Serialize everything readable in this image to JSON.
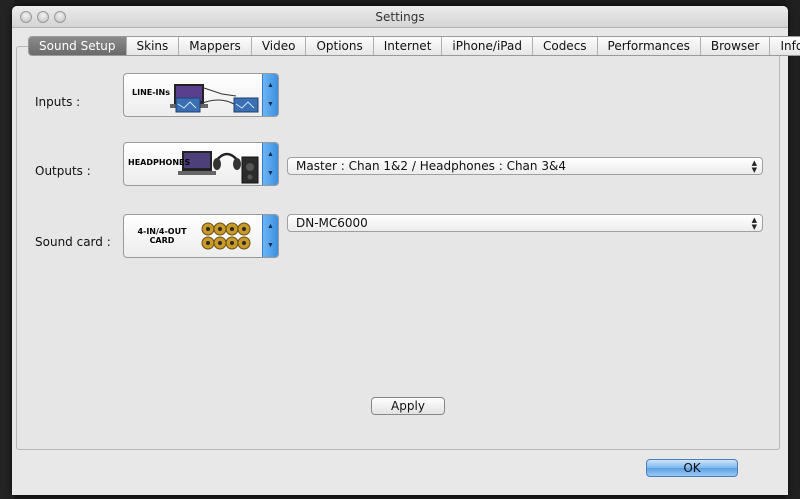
{
  "window": {
    "title": "Settings"
  },
  "tabs": [
    {
      "label": "Sound Setup",
      "active": true
    },
    {
      "label": "Skins"
    },
    {
      "label": "Mappers"
    },
    {
      "label": "Video"
    },
    {
      "label": "Options"
    },
    {
      "label": "Internet"
    },
    {
      "label": "iPhone/iPad"
    },
    {
      "label": "Codecs"
    },
    {
      "label": "Performances"
    },
    {
      "label": "Browser"
    },
    {
      "label": "Info"
    }
  ],
  "inputs": {
    "label": "Inputs :",
    "selector_text": "LINE-INs"
  },
  "outputs": {
    "label": "Outputs :",
    "selector_text": "HEADPHONES",
    "value": "Master : Chan 1&2 / Headphones : Chan 3&4"
  },
  "soundcard": {
    "label": "Sound card :",
    "selector_text": "4-IN/4-OUT CARD",
    "value": "DN-MC6000"
  },
  "buttons": {
    "apply": "Apply",
    "ok": "OK"
  },
  "colors": {
    "accent": "#4a9be8",
    "active_tab": "#7a7a7a"
  }
}
